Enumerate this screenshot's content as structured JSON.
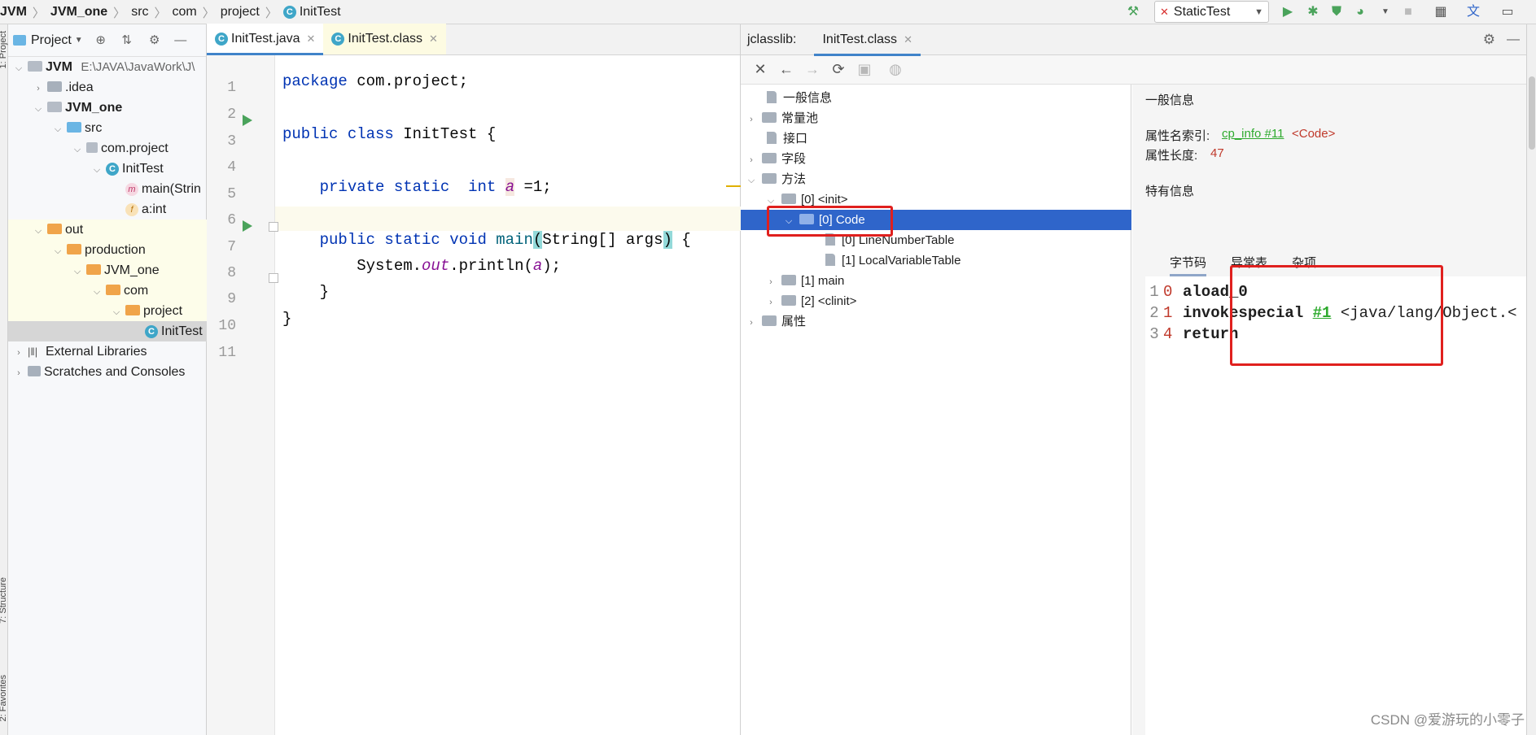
{
  "breadcrumbs": [
    "JVM",
    "JVM_one",
    "src",
    "com",
    "project",
    "InitTest"
  ],
  "toolbar": {
    "run_config": "StaticTest"
  },
  "left_stripe": {
    "project_label": "1: Project",
    "structure_label": "7: Structure",
    "favorites_label": "2: Favorites"
  },
  "project_panel": {
    "title": "Project",
    "tree": {
      "jvm": "JVM",
      "jvm_path": "E:\\JAVA\\JavaWork\\J\\",
      "idea": ".idea",
      "jvm_one": "JVM_one",
      "src": "src",
      "com_project": "com.project",
      "init_test": "InitTest",
      "main_method": "main(Strin",
      "field_a": "a:int",
      "out": "out",
      "production": "production",
      "prod_jvm_one": "JVM_one",
      "com": "com",
      "project": "project",
      "init_test_class": "InitTest",
      "external_libraries": "External Libraries",
      "scratches": "Scratches and Consoles"
    }
  },
  "editor": {
    "tabs": [
      "InitTest.java",
      "InitTest.class"
    ],
    "warnings": "2",
    "line_numbers": [
      "1",
      "2",
      "3",
      "4",
      "5",
      "6",
      "7",
      "8",
      "9",
      "10",
      "11"
    ],
    "code": {
      "l1_kw": "package",
      "l1_rest": " com.project;",
      "l3_kw": "public class",
      "l3_rest": " InitTest {",
      "l5_indent": "    ",
      "l5_kw1": "private static",
      "l5_sp": "  ",
      "l5_kw2": "int",
      "l5_sp2": " ",
      "l5_var": "a",
      "l5_rest": " =1;",
      "l7_indent": "    ",
      "l7_kw": "public static void",
      "l7_sp": " ",
      "l7_name": "main",
      "l7_lp": "(",
      "l7_params": "String[] args",
      "l7_rp": ")",
      "l7_end": " {",
      "l8_prefix": "        System.",
      "l8_out": "out",
      "l8_mid": ".println(",
      "l8_arg": "a",
      "l8_end": ");",
      "l9": "    }",
      "l10": "}"
    }
  },
  "jclasslib": {
    "label": "jclasslib:",
    "tab": "InitTest.class",
    "tree": {
      "general": "一般信息",
      "const_pool": "常量池",
      "interfaces": "接口",
      "fields": "字段",
      "methods": "方法",
      "init": "[0] <init>",
      "code": "[0] Code",
      "line_table": "[0] LineNumberTable",
      "local_table": "[1] LocalVariableTable",
      "main": "[1] main",
      "clinit": "[2] <clinit>",
      "attributes": "属性"
    },
    "detail": {
      "general_title": "一般信息",
      "attr_name_label": "属性名索引:",
      "attr_name_link": "cp_info #11",
      "attr_name_value": "<Code>",
      "attr_len_label": "属性长度:",
      "attr_len_value": "47",
      "specific_title": "特有信息",
      "tabs": [
        "字节码",
        "异常表",
        "杂项"
      ]
    },
    "bytecode": [
      {
        "n": "1",
        "off": "0",
        "instr": "aload_0",
        "ref": "",
        "rest": ""
      },
      {
        "n": "2",
        "off": "1",
        "instr": "invokespecial",
        "ref": "#1",
        "rest": "<java/lang/Object.<"
      },
      {
        "n": "3",
        "off": "4",
        "instr": "return",
        "ref": "",
        "rest": ""
      }
    ]
  },
  "watermark": "CSDN @爱游玩的小零子",
  "colors": {
    "accent": "#4083c9",
    "selection": "#2f65ca",
    "highlight_box": "#e0201e",
    "keyword": "#0033b3",
    "field": "#871094",
    "link": "#2eaa2e"
  }
}
